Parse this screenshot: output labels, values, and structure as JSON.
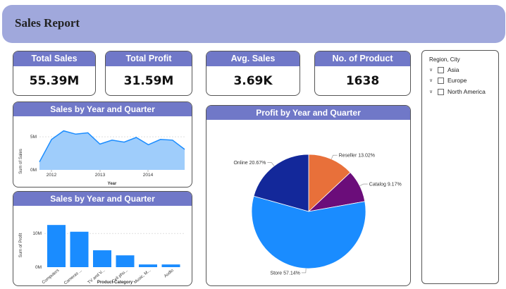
{
  "header": {
    "title": "Sales Report"
  },
  "kpis": [
    {
      "label": "Total Sales",
      "value": "55.39M"
    },
    {
      "label": "Total Profit",
      "value": "31.59M"
    },
    {
      "label": "Avg. Sales",
      "value": "3.69K"
    },
    {
      "label": "No. of Product",
      "value": "1638"
    }
  ],
  "slicer": {
    "title": "Region, City",
    "items": [
      "Asia",
      "Europe",
      "North America"
    ]
  },
  "chart_data": [
    {
      "type": "area",
      "title": "Sales by Year and Quarter",
      "xlabel": "Year",
      "ylabel": "Sum of Sales",
      "x_ticks": [
        "2012",
        "2013",
        "2014"
      ],
      "y_ticks": [
        "0M",
        "5M"
      ],
      "ylim": [
        0,
        6.5
      ],
      "values": [
        1.2,
        4.6,
        5.9,
        5.4,
        5.6,
        3.9,
        4.5,
        4.2,
        4.9,
        3.8,
        4.6,
        4.5,
        3.1
      ],
      "color": "#9fcdfb"
    },
    {
      "type": "bar",
      "title": "Sales by Year and Quarter",
      "xlabel": "Product Category",
      "ylabel": "Sum of Profit",
      "categories": [
        "Computers",
        "Cameras ...",
        "TV and V...",
        "Cell pho...",
        "Music, M...",
        "Audio"
      ],
      "values": [
        12.5,
        10.5,
        5.0,
        3.5,
        0.8,
        0.8
      ],
      "y_ticks": [
        "0M",
        "10M"
      ],
      "ylim": [
        0,
        14
      ],
      "color": "#1a8cff"
    },
    {
      "type": "pie",
      "title": "Profit by Year and Quarter",
      "slices": [
        {
          "label": "Reseller",
          "pct_label": "13.02%",
          "value": 13.02,
          "color": "#e8703a"
        },
        {
          "label": "Catalog",
          "pct_label": "9.17%",
          "value": 9.17,
          "color": "#6b0d7a"
        },
        {
          "label": "Store",
          "pct_label": "57.14%",
          "value": 57.14,
          "color": "#1a8cff"
        },
        {
          "label": "Online",
          "pct_label": "20.67%",
          "value": 20.67,
          "color": "#13289a"
        }
      ]
    }
  ]
}
